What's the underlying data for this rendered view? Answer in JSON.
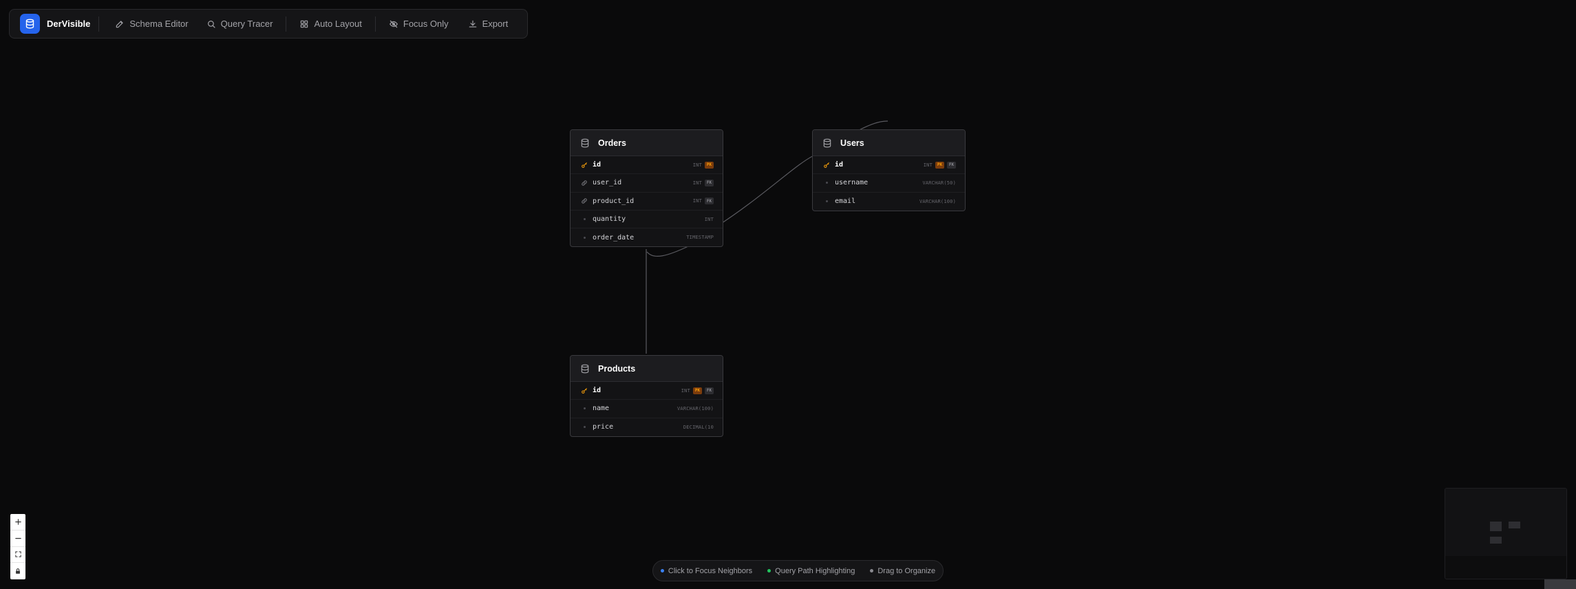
{
  "app": {
    "name": "DerVisible",
    "accent_color": "#2563eb",
    "logo_icon": "database-icon"
  },
  "toolbar": {
    "schema_editor": {
      "label": "Schema Editor",
      "icon": "pencil-icon"
    },
    "query_tracer": {
      "label": "Query Tracer",
      "icon": "search-icon"
    },
    "auto_layout": {
      "label": "Auto Layout",
      "icon": "grid-icon"
    },
    "focus_only": {
      "label": "Focus Only",
      "icon": "eye-off-icon"
    },
    "export": {
      "label": "Export",
      "icon": "download-icon"
    }
  },
  "tables": {
    "orders": {
      "name": "Orders",
      "columns": [
        {
          "name": "id",
          "type": "INT",
          "badges": [
            "PK"
          ],
          "kind": "pk"
        },
        {
          "name": "user_id",
          "type": "INT",
          "badges": [
            "FK"
          ],
          "kind": "fk"
        },
        {
          "name": "product_id",
          "type": "INT",
          "badges": [
            "FK"
          ],
          "kind": "fk"
        },
        {
          "name": "quantity",
          "type": "INT",
          "badges": [],
          "kind": "plain"
        },
        {
          "name": "order_date",
          "type": "TIMESTAMP",
          "badges": [],
          "kind": "plain"
        }
      ]
    },
    "users": {
      "name": "Users",
      "columns": [
        {
          "name": "id",
          "type": "INT",
          "badges": [
            "PK",
            "FK"
          ],
          "kind": "pk"
        },
        {
          "name": "username",
          "type": "VARCHAR(50)",
          "badges": [],
          "kind": "plain"
        },
        {
          "name": "email",
          "type": "VARCHAR(100)",
          "badges": [],
          "kind": "plain"
        }
      ]
    },
    "products": {
      "name": "Products",
      "columns": [
        {
          "name": "id",
          "type": "INT",
          "badges": [
            "PK",
            "FK"
          ],
          "kind": "pk"
        },
        {
          "name": "name",
          "type": "VARCHAR(100)",
          "badges": [],
          "kind": "plain"
        },
        {
          "name": "price",
          "type": "DECIMAL(10",
          "badges": [],
          "kind": "plain"
        }
      ]
    }
  },
  "legend": {
    "focus": {
      "label": "Click to Focus Neighbors",
      "color": "#3b82f6"
    },
    "query": {
      "label": "Query Path Highlighting",
      "color": "#22c55e"
    },
    "drag": {
      "label": "Drag to Organize",
      "color": "#8a8a90"
    }
  },
  "colors": {
    "pk": "#f59e0b",
    "edge": "#5a5a60"
  }
}
